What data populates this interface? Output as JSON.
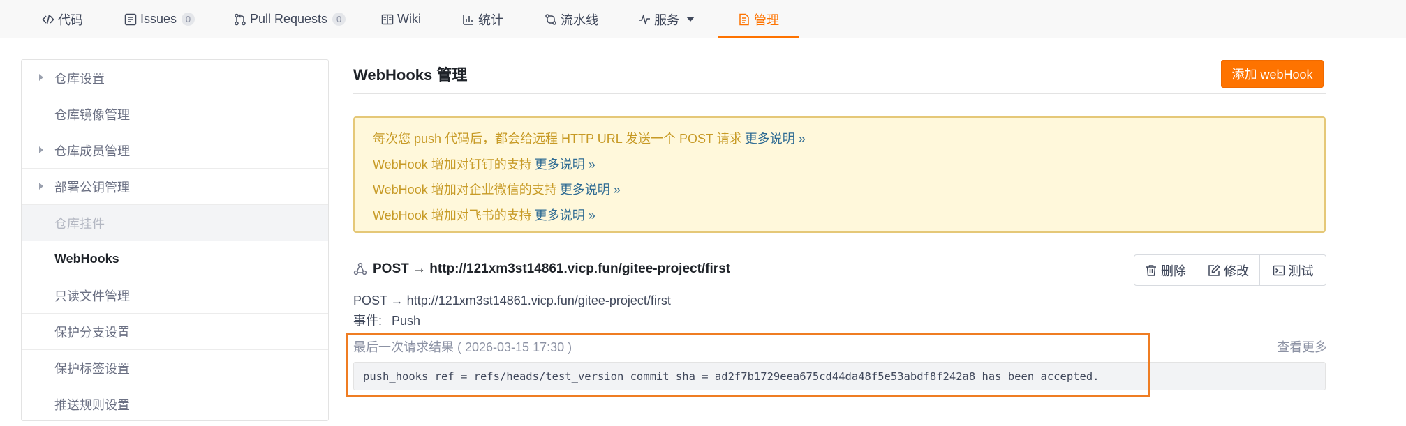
{
  "nav": {
    "tabs": [
      {
        "label": "代码",
        "icon": "code-icon"
      },
      {
        "label": "Issues",
        "icon": "issues-icon",
        "badge": "0"
      },
      {
        "label": "Pull Requests",
        "icon": "pull-request-icon",
        "badge": "0"
      },
      {
        "label": "Wiki",
        "icon": "wiki-icon"
      },
      {
        "label": "统计",
        "icon": "stats-icon"
      },
      {
        "label": "流水线",
        "icon": "pipeline-icon"
      },
      {
        "label": "服务",
        "icon": "service-icon"
      },
      {
        "label": "管理",
        "icon": "manage-icon",
        "active": true
      }
    ]
  },
  "sidebar": {
    "items": [
      {
        "label": "仓库设置"
      },
      {
        "label": "仓库镜像管理"
      },
      {
        "label": "仓库成员管理"
      },
      {
        "label": "部署公钥管理"
      },
      {
        "label": "仓库挂件"
      },
      {
        "label": "WebHooks",
        "active": true
      },
      {
        "label": "只读文件管理"
      },
      {
        "label": "保护分支设置"
      },
      {
        "label": "保护标签设置"
      },
      {
        "label": "推送规则设置"
      }
    ]
  },
  "main": {
    "title": "WebHooks 管理",
    "add_button": "添加 webHook"
  },
  "notice": {
    "lines": [
      {
        "text": "每次您 push 代码后，都会给远程 HTTP URL 发送一个 POST 请求",
        "link": "更多说明 »"
      },
      {
        "text": "WebHook 增加对钉钉的支持",
        "link": "更多说明 »"
      },
      {
        "text": "WebHook 增加对企业微信的支持",
        "link": "更多说明 »"
      },
      {
        "text": "WebHook 增加对飞书的支持",
        "link": "更多说明 »"
      }
    ]
  },
  "hook": {
    "heading": "POST → http://121xm3st14861.vicp.fun/gitee-project/first",
    "url_line": "POST → http://121xm3st14861.vicp.fun/gitee-project/first",
    "event_label": "事件:",
    "event_value": "Push",
    "actions": {
      "delete": "删除",
      "edit": "修改",
      "test": "测试"
    },
    "last_result_label": "最后一次请求结果 ( 2026-03-15 17:30 )",
    "more_label": "查看更多",
    "result_text": "push_hooks ref = refs/heads/test_version commit sha = ad2f7b1729eea675cd44da48f5e53abdf8f242a8 has been accepted."
  },
  "colors": {
    "accent": "#fe7300",
    "notice_bg": "#fff8db",
    "notice_text": "#c79a25",
    "link": "#2f6b93",
    "highlight": "#ef7d23"
  }
}
